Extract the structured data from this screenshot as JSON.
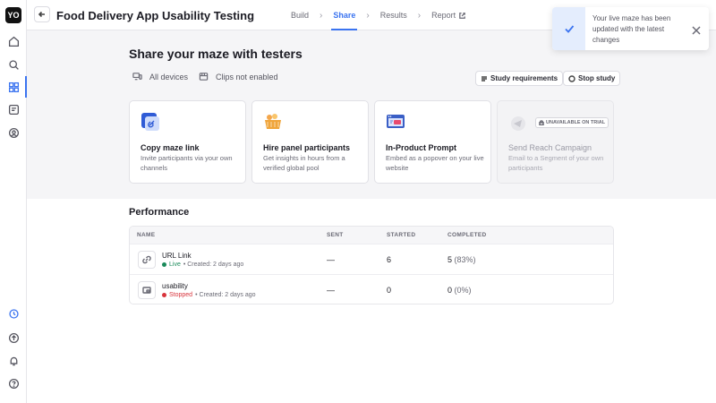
{
  "sidebar": {
    "logo": "YO",
    "items": [
      {
        "icon": "home-icon"
      },
      {
        "icon": "search-icon"
      },
      {
        "icon": "grid-icon"
      },
      {
        "icon": "templates-icon"
      },
      {
        "icon": "participants-icon"
      }
    ],
    "bottom_items": [
      {
        "icon": "activity-icon"
      },
      {
        "icon": "upgrade-icon"
      },
      {
        "icon": "bell-icon"
      },
      {
        "icon": "help-icon"
      }
    ]
  },
  "header": {
    "title": "Food Delivery App Usability Testing",
    "steps": [
      "Build",
      "Share",
      "Results",
      "Report"
    ],
    "active_step": "Share"
  },
  "toast": {
    "message": "Your live maze has been updated with the latest changes"
  },
  "share": {
    "title": "Share your maze with testers",
    "devices_label": "All devices",
    "clips_label": "Clips not enabled",
    "study_requirements_label": "Study requirements",
    "stop_study_label": "Stop study"
  },
  "cards": [
    {
      "title": "Copy maze link",
      "desc": "Invite participants via your own channels",
      "icon": "link-card-icon"
    },
    {
      "title": "Hire panel participants",
      "desc": "Get insights in hours from a verified global pool",
      "icon": "basket-card-icon"
    },
    {
      "title": "In-Product Prompt",
      "desc": "Embed as a popover on your live website",
      "icon": "browser-card-icon"
    },
    {
      "title": "Send Reach Campaign",
      "desc": "Email to a Segment of your own participants",
      "icon": "campaign-card-icon",
      "badge": "UNAVAILABLE ON TRIAL"
    }
  ],
  "performance": {
    "title": "Performance",
    "columns": [
      "NAME",
      "SENT",
      "STARTED",
      "COMPLETED"
    ],
    "rows": [
      {
        "name": "URL Link",
        "status": "Live",
        "created": "• Created: 2 days ago",
        "sent": "—",
        "started": "6",
        "completed": "5",
        "completed_pct": "(83%)",
        "icon": "link-icon"
      },
      {
        "name": "usability",
        "status": "Stopped",
        "created": "• Created: 2 days ago",
        "sent": "—",
        "started": "0",
        "completed": "0",
        "completed_pct": "(0%)",
        "icon": "prompt-icon"
      }
    ]
  },
  "colors": {
    "accent": "#3b74f0",
    "live": "#1a8a5a",
    "stopped": "#d8343c"
  }
}
